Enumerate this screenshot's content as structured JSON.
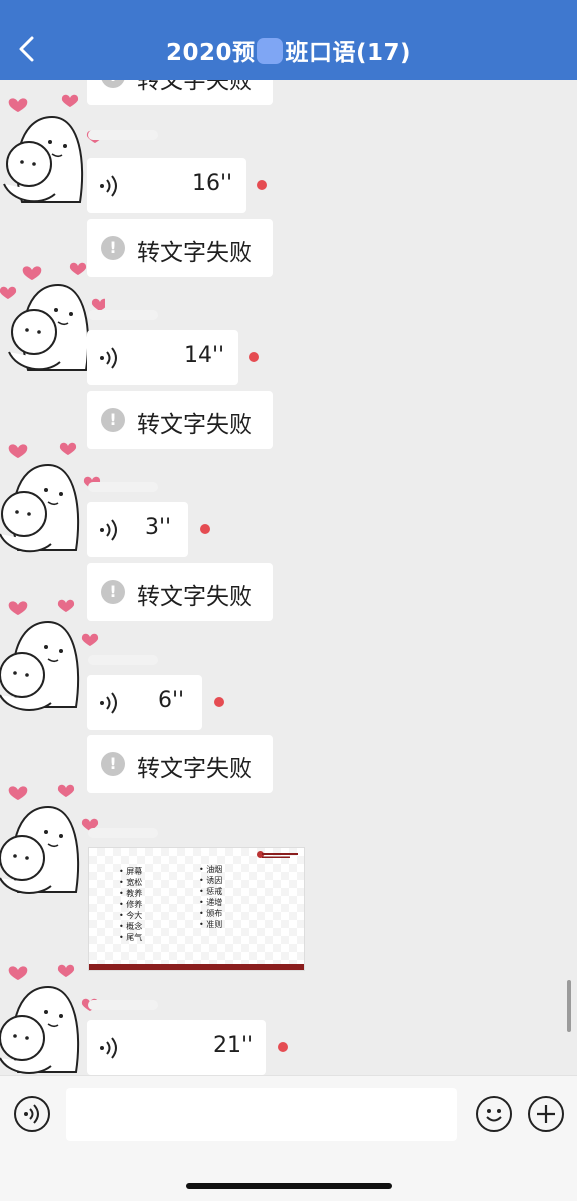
{
  "header": {
    "title_prefix": "2020预",
    "title_suffix": "班口语(17)",
    "back_icon": "chevron-left-icon",
    "background": "#3f78cf"
  },
  "messages": {
    "fail_text": "转文字失败",
    "voices": [
      "16''",
      "14''",
      "3''",
      "6''",
      "21''"
    ],
    "unread_color": "#e54c52"
  },
  "slide": {
    "left_column": [
      "屏幕",
      "宽松",
      "教养",
      "修养",
      "今大",
      "概念",
      "尾气"
    ],
    "right_column": [
      "油烟",
      "诱因",
      "惩戒",
      "递增",
      "颁布",
      "准则"
    ]
  },
  "input_bar": {
    "voice_icon": "voice-input-icon",
    "emoji_icon": "emoji-icon",
    "plus_icon": "plus-icon",
    "input_value": ""
  }
}
